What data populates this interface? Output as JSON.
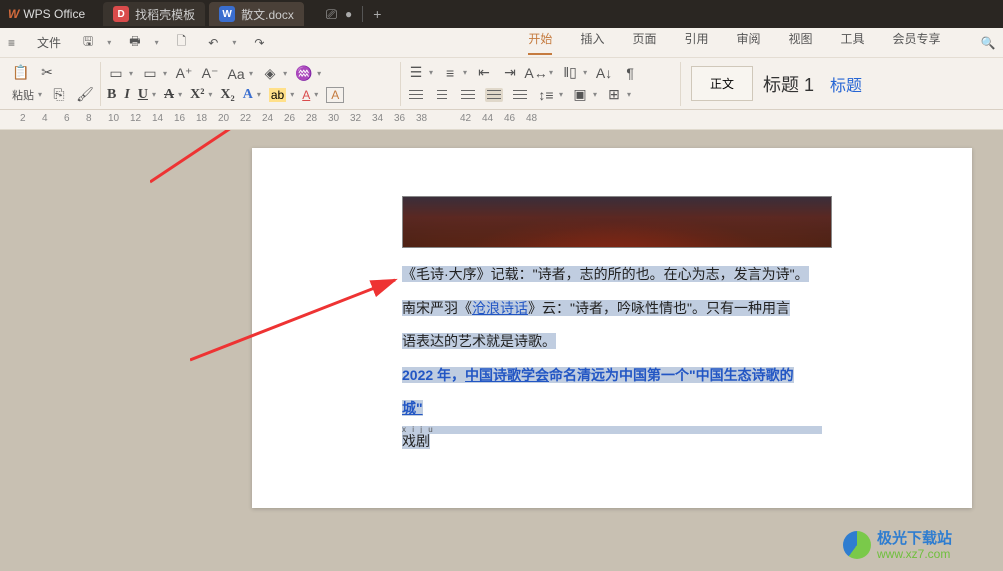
{
  "titlebar": {
    "app_name": "WPS Office",
    "tab1": "找稻壳模板",
    "tab2": "散文.docx",
    "plus": "+"
  },
  "menubar": {
    "hamburger": "≡",
    "file": "文件",
    "tabs": [
      "开始",
      "插入",
      "页面",
      "引用",
      "审阅",
      "视图",
      "工具",
      "会员专享"
    ],
    "active_index": 0
  },
  "ribbon": {
    "paste_label": "粘贴",
    "bold": "B",
    "italic": "I",
    "underline": "U",
    "strike": "A",
    "sup": "X²",
    "sub": "X₂",
    "aa": "A",
    "hl": "ab",
    "fc": "A",
    "box": "A",
    "style_normal": "正文",
    "style_h1": "标题 1",
    "style_h": "标题"
  },
  "ruler": {
    "nums": [
      10,
      8,
      6,
      4,
      2,
      "",
      2,
      4,
      6,
      8,
      10,
      12,
      14,
      16,
      18,
      20,
      22,
      24,
      26,
      28,
      30,
      32,
      34,
      36,
      38,
      "",
      42,
      44,
      46,
      48
    ]
  },
  "document": {
    "p1a": "《毛诗·大序》记载：\"诗者，志的所的也。在心为志，发言为诗\"。",
    "p2a": "南宋严羽《",
    "p2link": "沧浪诗话",
    "p2b": "》云：\"诗者，吟咏性情也\"。只有一种用言",
    "p3": "语表达的艺术就是诗歌。",
    "p4a": "2022 年，",
    "p4link": "中国诗歌学会",
    "p4b": "命名清远为中国第一个\"中国生态诗歌的",
    "p5": "城\"",
    "ruby": "x i j u",
    "p6": "戏剧"
  },
  "watermark": {
    "line1": "极光下载站",
    "line2": "www.xz7.com"
  }
}
